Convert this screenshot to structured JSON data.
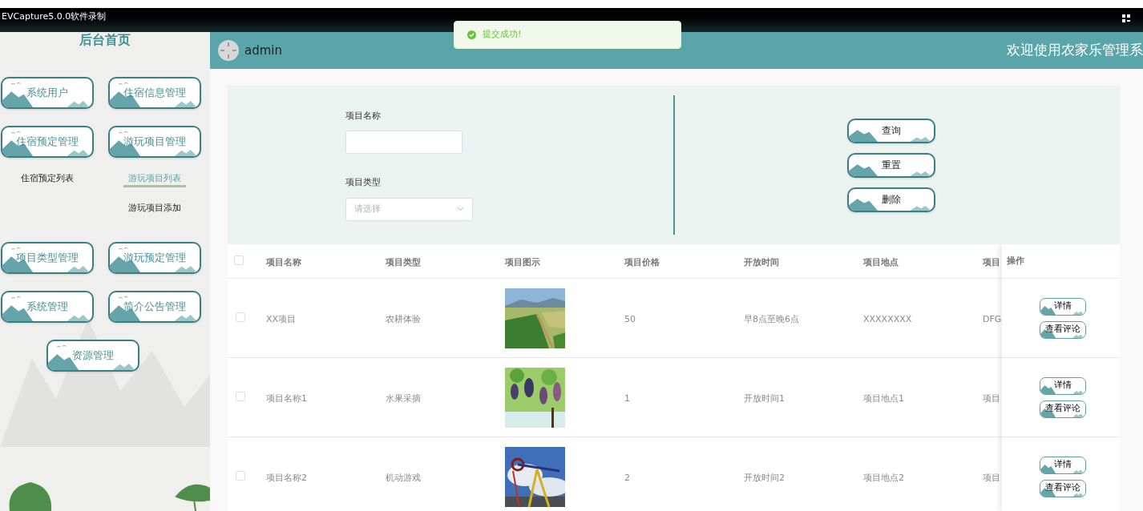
{
  "recorder_bar": {
    "title": "EVCapture5.0.0软件录制"
  },
  "sidebar": {
    "title": "后台首页",
    "menu": [
      {
        "label": "系统用户"
      },
      {
        "label": "住宿信息管理"
      },
      {
        "label": "住宿预定管理",
        "expanded": true,
        "children": [
          {
            "label": "住宿预定列表",
            "selected": false
          }
        ]
      },
      {
        "label": "游玩项目管理",
        "expanded": true,
        "children": [
          {
            "label": "游玩项目列表",
            "selected": true
          },
          {
            "label": "游玩项目添加",
            "selected": false
          }
        ]
      },
      {
        "label": "项目类型管理"
      },
      {
        "label": "游玩预定管理"
      },
      {
        "label": "系统管理"
      },
      {
        "label": "简介公告管理"
      },
      {
        "label": "资源管理"
      }
    ]
  },
  "header": {
    "user": "admin",
    "title": "欢迎使用农家乐管理系"
  },
  "toast": {
    "kind": "success",
    "message": "提交成功!"
  },
  "search": {
    "fields": [
      {
        "label": "项目名称",
        "kind": "input"
      },
      {
        "label": "项目类型",
        "kind": "select",
        "placeholder": "请选择"
      }
    ],
    "buttons": [
      "查询",
      "重置",
      "删除"
    ]
  },
  "table": {
    "select_all": {
      "checked": false
    },
    "columns": [
      "项目名称",
      "项目类型",
      "项目图示",
      "项目价格",
      "开放时间",
      "项目地点",
      "项目"
    ],
    "action_column": "操作",
    "rows": [
      {
        "checked": false,
        "cells": [
          "XX项目",
          "农耕体验",
          {
            "kind": "picture"
          },
          "50",
          "早8点至晚6点",
          "XXXXXXXX",
          "DFG"
        ],
        "actions": [
          "详情",
          "查看评论"
        ]
      },
      {
        "checked": false,
        "cells": [
          "项目名称1",
          "水果采摘",
          {
            "kind": "picture"
          },
          "1",
          "开放时间1",
          "项目地点1",
          "项目"
        ],
        "actions": [
          "详情",
          "查看评论"
        ]
      },
      {
        "checked": false,
        "cells": [
          "项目名称2",
          "机动游戏",
          {
            "kind": "picture"
          },
          "2",
          "开放时间2",
          "项目地点2",
          "项目"
        ],
        "actions": [
          "详情",
          "查看评论"
        ]
      }
    ]
  }
}
